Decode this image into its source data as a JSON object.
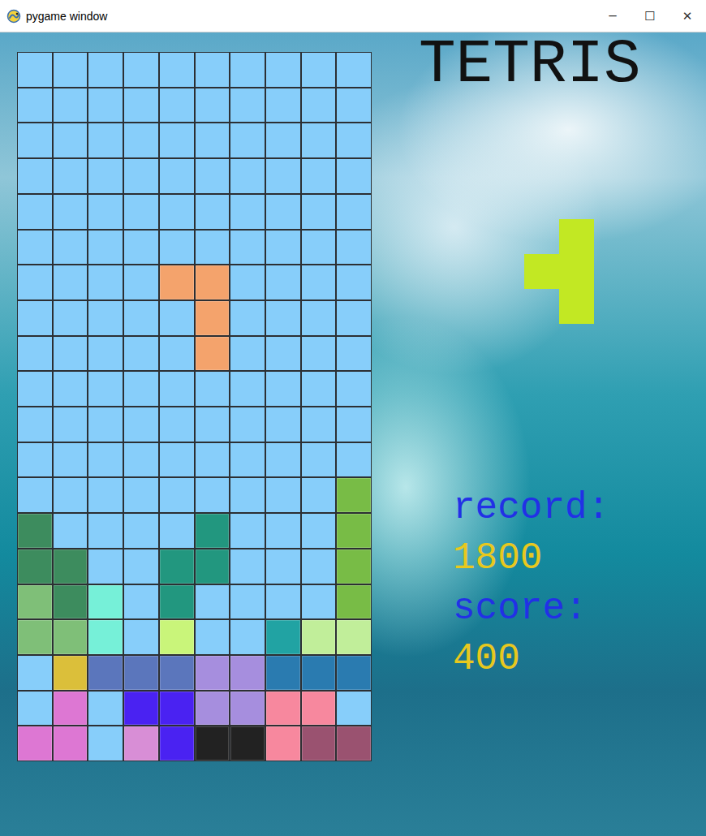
{
  "window": {
    "title": "pygame window",
    "controls": [
      "─",
      "☐",
      "✕"
    ]
  },
  "title": "TETRIS",
  "board": {
    "rows": [
      [
        "",
        "",
        "",
        "",
        "",
        "",
        "",
        "",
        "",
        ""
      ],
      [
        "",
        "",
        "",
        "",
        "",
        "",
        "",
        "",
        "",
        ""
      ],
      [
        "",
        "",
        "",
        "",
        "",
        "",
        "",
        "",
        "",
        ""
      ],
      [
        "",
        "",
        "",
        "",
        "",
        "",
        "",
        "",
        "",
        ""
      ],
      [
        "",
        "",
        "",
        "",
        "",
        "",
        "",
        "",
        "",
        ""
      ],
      [
        "",
        "",
        "",
        "",
        "",
        "",
        "",
        "",
        "",
        ""
      ],
      [
        "",
        "",
        "",
        "",
        "#f4a36c",
        "#f4a36c",
        "",
        "",
        "",
        ""
      ],
      [
        "",
        "",
        "",
        "",
        "",
        "#f4a36c",
        "",
        "",
        "",
        ""
      ],
      [
        "",
        "",
        "",
        "",
        "",
        "#f4a36c",
        "",
        "",
        "",
        ""
      ],
      [
        "",
        "",
        "",
        "",
        "",
        "",
        "",
        "",
        "",
        ""
      ],
      [
        "",
        "",
        "",
        "",
        "",
        "",
        "",
        "",
        "",
        ""
      ],
      [
        "",
        "",
        "",
        "",
        "",
        "",
        "",
        "",
        "",
        ""
      ],
      [
        "",
        "",
        "",
        "",
        "",
        "",
        "",
        "",
        "",
        "#78bc46"
      ],
      [
        "#3d8c5e",
        "",
        "",
        "",
        "",
        "#22977f",
        "",
        "",
        "",
        "#78bc46"
      ],
      [
        "#3d8c5e",
        "#3d8c5e",
        "",
        "",
        "#22977f",
        "#22977f",
        "",
        "",
        "",
        "#78bc46"
      ],
      [
        "#7fbf78",
        "#3d8c5e",
        "#76f0d8",
        "",
        "#22977f",
        "",
        "",
        "",
        "",
        "#78bc46"
      ],
      [
        "#7fbf78",
        "#7fbf78",
        "#76f0d8",
        "",
        "#c9f57a",
        "",
        "",
        "#21a3a3",
        "#c1ee9a",
        "#c1ee9a"
      ],
      [
        "",
        "#dbbf3a",
        "#5b76bc",
        "#5b76bc",
        "#5b76bc",
        "#a68ede",
        "#a68ede",
        "#2a7bb0",
        "#2a7bb0",
        "#2a7bb0"
      ],
      [
        "",
        "#dd77d3",
        "",
        "#4a22f2",
        "#4a22f2",
        "#a68ede",
        "#a68ede",
        "#f7889e",
        "#f7889e",
        ""
      ],
      [
        "#dd77d3",
        "#dd77d3",
        "",
        "#d88ed6",
        "#4a22f2",
        "#222222",
        "#222222",
        "#f7889e",
        "#9a5270",
        "#9a5270"
      ]
    ]
  },
  "next_piece": {
    "rows": [
      [
        "",
        "#c2e823"
      ],
      [
        "#c2e823",
        "#c2e823"
      ],
      [
        "",
        "#c2e823"
      ]
    ]
  },
  "stats": [
    {
      "label": "record:",
      "value": "1800"
    },
    {
      "label": "score:",
      "value": "400"
    }
  ]
}
